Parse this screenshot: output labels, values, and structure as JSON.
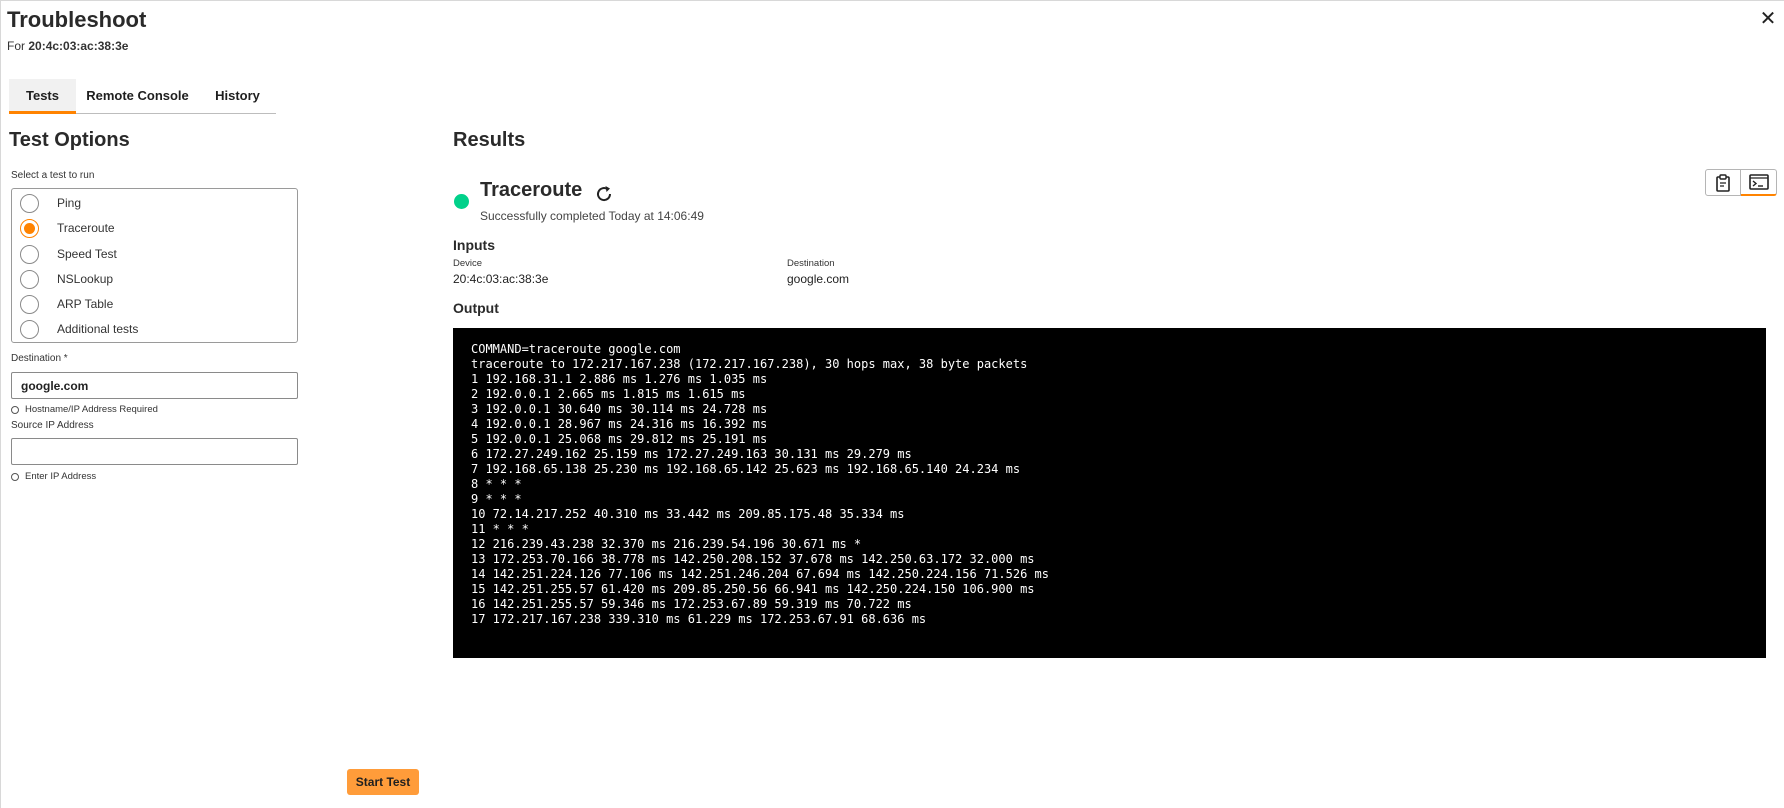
{
  "header": {
    "title": "Troubleshoot",
    "subtitle_prefix": "For",
    "device_id": "20:4c:03:ac:38:3e",
    "close_symbol": "✕"
  },
  "tabs": [
    {
      "label": "Tests",
      "active": true
    },
    {
      "label": "Remote Console",
      "active": false
    },
    {
      "label": "History",
      "active": false
    }
  ],
  "test_options": {
    "heading": "Test Options",
    "select_label": "Select a test to run",
    "tests": [
      {
        "label": "Ping",
        "selected": false
      },
      {
        "label": "Traceroute",
        "selected": true
      },
      {
        "label": "Speed Test",
        "selected": false
      },
      {
        "label": "NSLookup",
        "selected": false
      },
      {
        "label": "ARP Table",
        "selected": false
      },
      {
        "label": "Additional tests",
        "selected": false
      }
    ],
    "destination_label": "Destination *",
    "destination_value": "google.com",
    "destination_hint": "Hostname/IP Address Required",
    "source_ip_label": "Source IP Address",
    "source_ip_value": "",
    "source_ip_hint": "Enter IP Address",
    "start_button": "Start Test"
  },
  "results": {
    "heading": "Results",
    "test_name": "Traceroute",
    "status_text": "Successfully completed Today at 14:06:49",
    "status_color": "#01d18a",
    "inputs_heading": "Inputs",
    "device_label": "Device",
    "device_value": "20:4c:03:ac:38:3e",
    "destination_label": "Destination",
    "destination_value": "google.com",
    "output_heading": "Output",
    "output_lines": [
      "COMMAND=traceroute google.com",
      "traceroute to 172.217.167.238 (172.217.167.238), 30 hops max, 38 byte packets",
      "1 192.168.31.1 2.886 ms 1.276 ms 1.035 ms",
      "2 192.0.0.1 2.665 ms 1.815 ms 1.615 ms",
      "3 192.0.0.1 30.640 ms 30.114 ms 24.728 ms",
      "4 192.0.0.1 28.967 ms 24.316 ms 16.392 ms",
      "5 192.0.0.1 25.068 ms 29.812 ms 25.191 ms",
      "6 172.27.249.162 25.159 ms 172.27.249.163 30.131 ms 29.279 ms",
      "7 192.168.65.138 25.230 ms 192.168.65.142 25.623 ms 192.168.65.140 24.234 ms",
      "8 * * *",
      "9 * * *",
      "10 72.14.217.252 40.310 ms 33.442 ms 209.85.175.48 35.334 ms",
      "11 * * *",
      "12 216.239.43.238 32.370 ms 216.239.54.196 30.671 ms *",
      "13 172.253.70.166 38.778 ms 142.250.208.152 37.678 ms 142.250.63.172 32.000 ms",
      "14 142.251.224.126 77.106 ms 142.251.246.204 67.694 ms 142.250.224.156 71.526 ms",
      "15 142.251.255.57 61.420 ms 209.85.250.56 66.941 ms 142.250.224.150 106.900 ms",
      "16 142.251.255.57 59.346 ms 172.253.67.89 59.319 ms 70.722 ms",
      "17 172.217.167.238 339.310 ms 61.229 ms 172.253.67.91 68.636 ms"
    ],
    "tools": [
      {
        "icon": "clipboard-icon"
      },
      {
        "icon": "terminal-icon"
      }
    ]
  },
  "colors": {
    "accent": "#ff8300",
    "button": "#ff9c3a",
    "terminal_bg": "#000000"
  }
}
